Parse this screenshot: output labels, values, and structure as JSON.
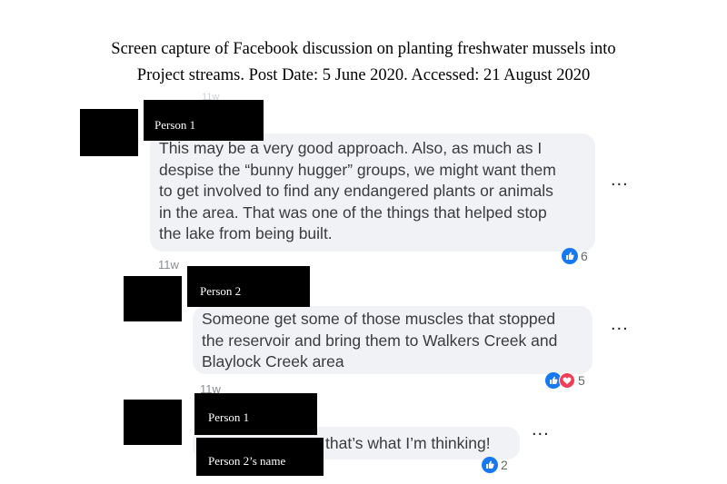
{
  "caption": {
    "line1": "Screen capture of Facebook discussion on planting freshwater mussels into",
    "line2": "Project streams. Post Date: 5 June 2020. Accessed: 21 August 2020"
  },
  "comments": [
    {
      "author": "Person 1",
      "lines": [
        "This may be a very good approach. Also, as much as I",
        "despise the “bunny hugger” groups, we might want them",
        "to get involved to find any endangered plants or animals",
        "in the area. That was one of the things that helped stop",
        "the lake from being built."
      ],
      "timestamp": "11w",
      "reaction_icons": [
        "like-icon"
      ],
      "reaction_count": "6",
      "more": "..."
    },
    {
      "author": "Person 2",
      "lines": [
        "Someone get some of those muscles that stopped",
        "the reservoir and bring them to Walkers Creek and",
        "Blaylock Creek area"
      ],
      "timestamp": "11w",
      "reaction_icons": [
        "like-icon",
        "love-icon"
      ],
      "reaction_count": "5",
      "more": "..."
    },
    {
      "author": "Person 1",
      "mention": "Person 2’s name",
      "text": "that’s what I’m thinking!",
      "timestamp": "11w",
      "reaction_icons": [
        "like-icon"
      ],
      "reaction_count": "2",
      "more": "..."
    }
  ],
  "colors": {
    "like": "#1877f2",
    "love": "#f33e58",
    "bubble": "#f0f2f5",
    "redaction": "#000000"
  }
}
